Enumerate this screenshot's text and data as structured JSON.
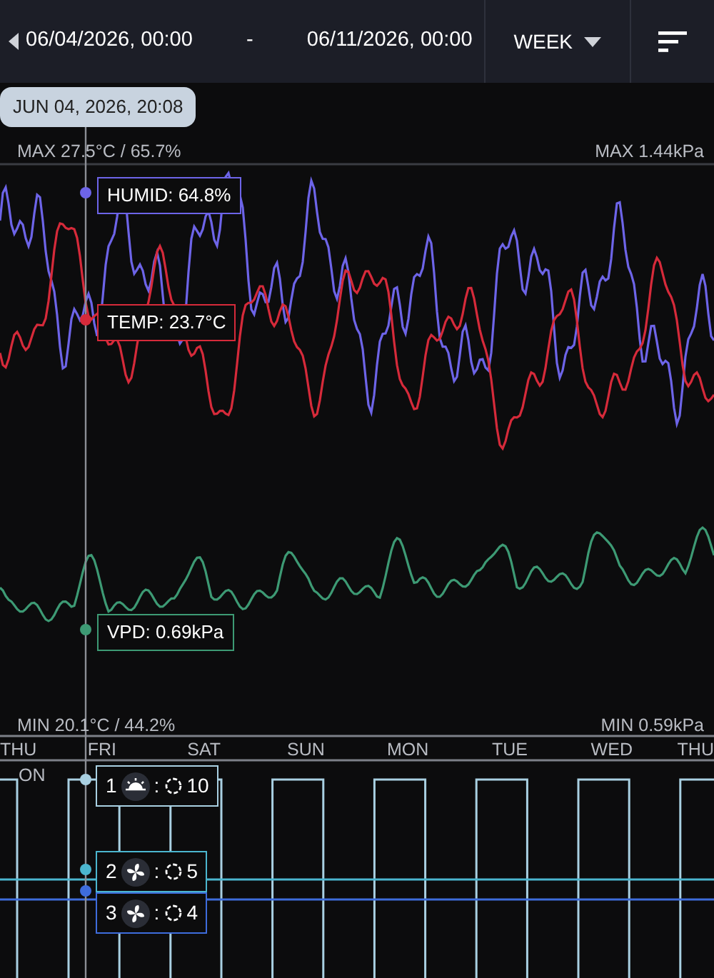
{
  "header": {
    "start": "06/04/2026, 00:00",
    "separator": "-",
    "end": "06/11/2026, 00:00",
    "range": "WEEK"
  },
  "tooltip": "JUN 04, 2026, 20:08",
  "climate": {
    "max_left": "MAX 27.5°C / 65.7%",
    "max_right": "MAX 1.44kPa",
    "min_left": "MIN 20.1°C / 44.2%",
    "min_right": "MIN 0.59kPa",
    "series": [
      {
        "kind": "humidity",
        "label": "HUMID: 64.8%",
        "color": "#6d64e8"
      },
      {
        "kind": "temperature",
        "label": "TEMP: 23.7°C",
        "color": "#d62a3a"
      },
      {
        "kind": "vpd",
        "label": "VPD: 0.69kPa",
        "color": "#3d9a74"
      }
    ]
  },
  "days": [
    "THU",
    "FRI",
    "SAT",
    "SUN",
    "MON",
    "TUE",
    "WED",
    "THU"
  ],
  "devices": {
    "state_label": "ON",
    "items": [
      {
        "index": "1",
        "kind": "light",
        "separator": ":",
        "value": "10",
        "color": "#a9d0e2"
      },
      {
        "index": "2",
        "kind": "fan",
        "separator": ":",
        "value": "5",
        "color": "#4bb6cf"
      },
      {
        "index": "3",
        "kind": "fan",
        "separator": ":",
        "value": "4",
        "color": "#3e6cdc"
      }
    ]
  }
}
